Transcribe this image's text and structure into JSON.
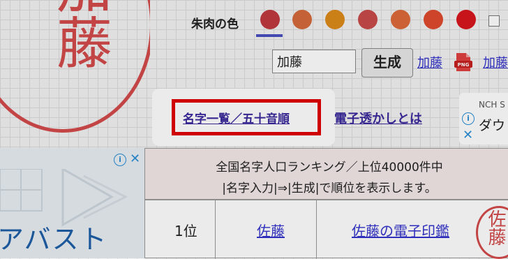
{
  "stamp": {
    "text": "加藤"
  },
  "color_picker": {
    "label": "朱肉の色",
    "swatches": [
      "#c0393f",
      "#d66a3c",
      "#dd8a1a",
      "#c94a4a",
      "#de6a3a",
      "#e04a2e",
      "#d8161e"
    ],
    "selected_index": 0,
    "underline_color": "#4a4fc0"
  },
  "form": {
    "name_value": "加藤",
    "generate_label": "生成",
    "result_link": "加藤",
    "png_icon": "png-file-icon",
    "result_link2": "加藤"
  },
  "links": {
    "list_label": "名字一覧／五十音順",
    "watermark_label": "電子透かしとは"
  },
  "ad_right": {
    "brand": "NCH S",
    "text": "ダウ"
  },
  "ad_left": {
    "brand": "アバスト"
  },
  "ranking": {
    "header_line1": "全国名字人口ランキング／上位40000件中",
    "header_line2": "|名字入力|⇒|生成|で順位を表示します。",
    "rows": [
      {
        "rank": "1位",
        "name": "佐藤",
        "stamp_link": "佐藤の電子印鑑",
        "stamp_text": "佐藤"
      }
    ]
  },
  "colors": {
    "highlight": "#e00000",
    "link": "#3333cc",
    "stamp": "#d34a4a"
  }
}
